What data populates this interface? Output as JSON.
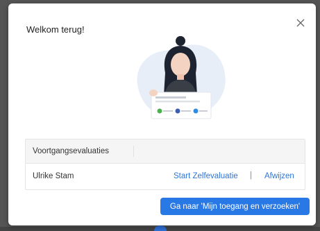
{
  "dialog": {
    "title": "Welkom terug!",
    "close_icon": "close-icon"
  },
  "illustration": {
    "icon": "person-presenting-checklist-illustration",
    "accent_color": "#2878e6"
  },
  "table": {
    "header": "Voortgangsevaluaties",
    "rows": [
      {
        "name": "Ulrike Stam",
        "action_primary": "Start Zelfevaluatie",
        "separator": "|",
        "action_secondary": "Afwijzen"
      }
    ]
  },
  "footer": {
    "cta_label": "Ga naar 'Mijn toegang en verzoeken'"
  },
  "colors": {
    "link": "#2e74d6",
    "primary_button": "#2878e6"
  }
}
